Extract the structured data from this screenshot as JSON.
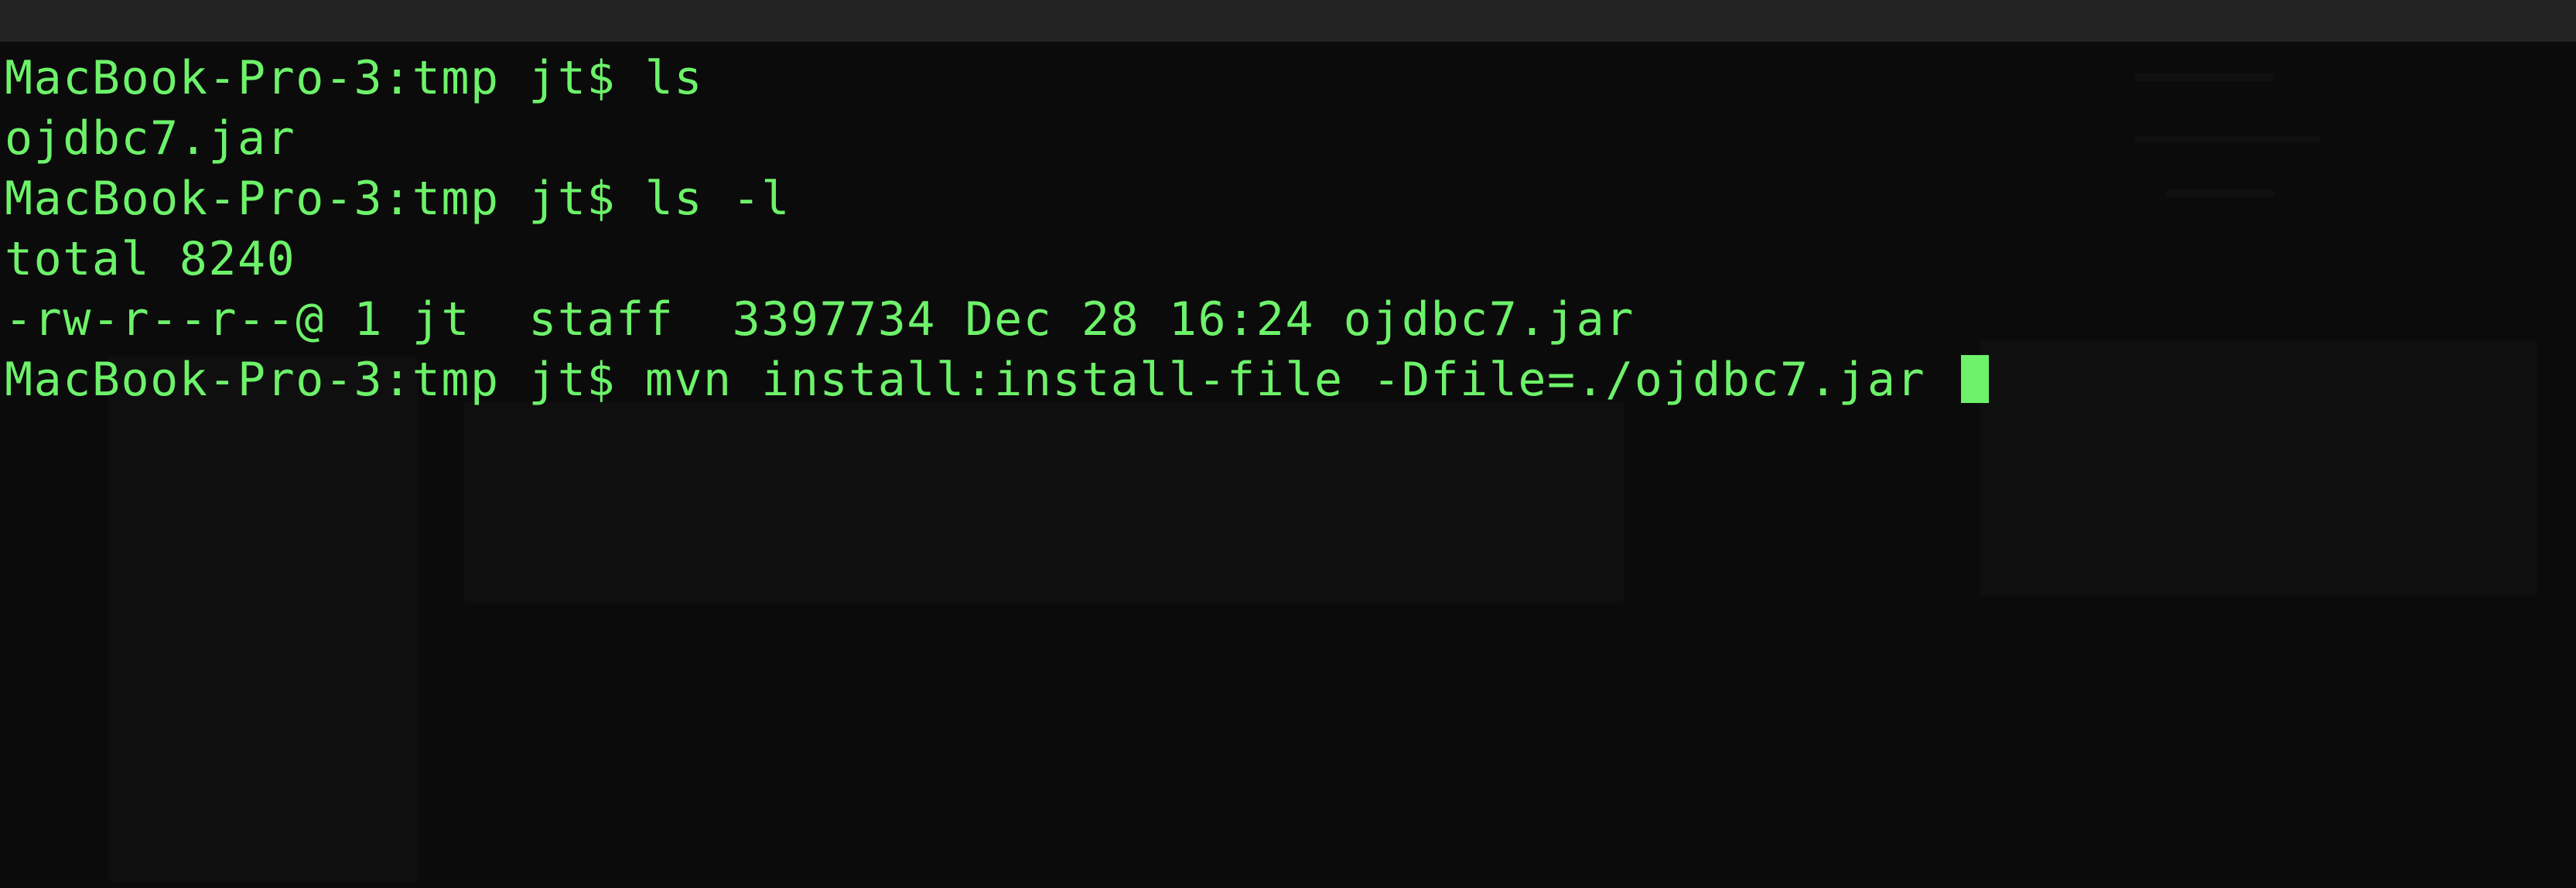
{
  "window": {
    "title": ""
  },
  "terminal": {
    "text_color": "#6df26a",
    "background_color": "#0b0b0c",
    "lines": [
      {
        "kind": "prompt",
        "prompt": "MacBook-Pro-3:tmp jt$ ",
        "command": "ls"
      },
      {
        "kind": "output",
        "text": "ojdbc7.jar"
      },
      {
        "kind": "prompt",
        "prompt": "MacBook-Pro-3:tmp jt$ ",
        "command": "ls -l"
      },
      {
        "kind": "output",
        "text": "total 8240"
      },
      {
        "kind": "output",
        "text": "-rw-r--r--@ 1 jt  staff  3397734 Dec 28 16:24 ojdbc7.jar"
      },
      {
        "kind": "prompt",
        "prompt": "MacBook-Pro-3:tmp jt$ ",
        "command": "mvn install:install-file -Dfile=./ojdbc7.jar "
      }
    ],
    "cursor": "block-cursor"
  }
}
